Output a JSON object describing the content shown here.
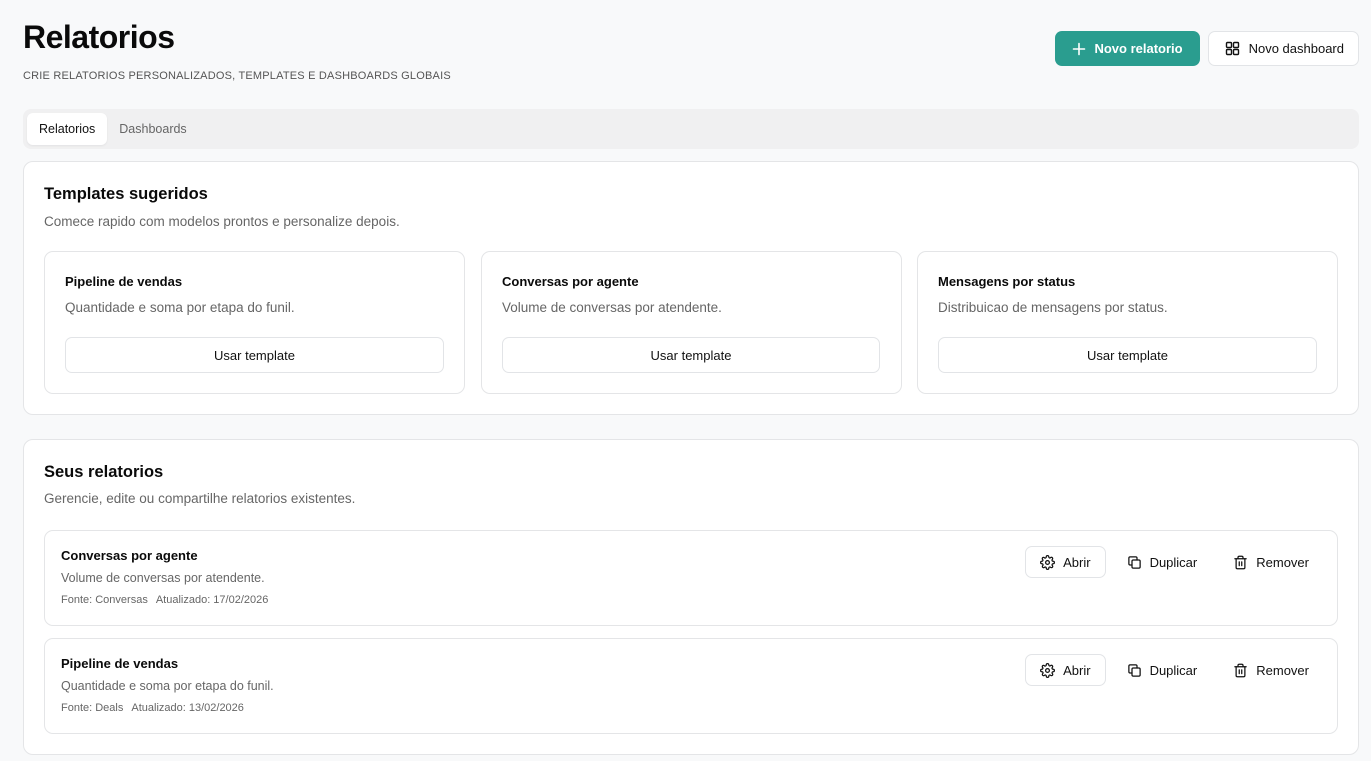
{
  "header": {
    "title": "Relatorios",
    "subtitle": "CRIE RELATORIOS PERSONALIZADOS, TEMPLATES E DASHBOARDS GLOBAIS",
    "new_report_label": "Novo relatorio",
    "new_dashboard_label": "Novo dashboard"
  },
  "tabs": [
    {
      "label": "Relatorios",
      "active": true
    },
    {
      "label": "Dashboards",
      "active": false
    }
  ],
  "templates": {
    "title": "Templates sugeridos",
    "description": "Comece rapido com modelos prontos e personalize depois.",
    "items": [
      {
        "title": "Pipeline de vendas",
        "description": "Quantidade e soma por etapa do funil.",
        "button_label": "Usar template"
      },
      {
        "title": "Conversas por agente",
        "description": "Volume de conversas por atendente.",
        "button_label": "Usar template"
      },
      {
        "title": "Mensagens por status",
        "description": "Distribuicao de mensagens por status.",
        "button_label": "Usar template"
      }
    ]
  },
  "reports": {
    "title": "Seus relatorios",
    "description": "Gerencie, edite ou compartilhe relatorios existentes.",
    "actions": {
      "open": "Abrir",
      "duplicate": "Duplicar",
      "remove": "Remover"
    },
    "items": [
      {
        "title": "Conversas por agente",
        "description": "Volume de conversas por atendente.",
        "source": "Fonte: Conversas",
        "updated": "Atualizado: 17/02/2026"
      },
      {
        "title": "Pipeline de vendas",
        "description": "Quantidade e soma por etapa do funil.",
        "source": "Fonte: Deals",
        "updated": "Atualizado: 13/02/2026"
      }
    ]
  },
  "colors": {
    "accent": "#2a9d8f",
    "border": "#e4e5e7",
    "background": "#f8f9fa"
  },
  "icons": {
    "new_report": "plus-icon",
    "new_dashboard": "grid-icon",
    "open": "gear-icon",
    "duplicate": "copy-icon",
    "remove": "trash-icon"
  }
}
